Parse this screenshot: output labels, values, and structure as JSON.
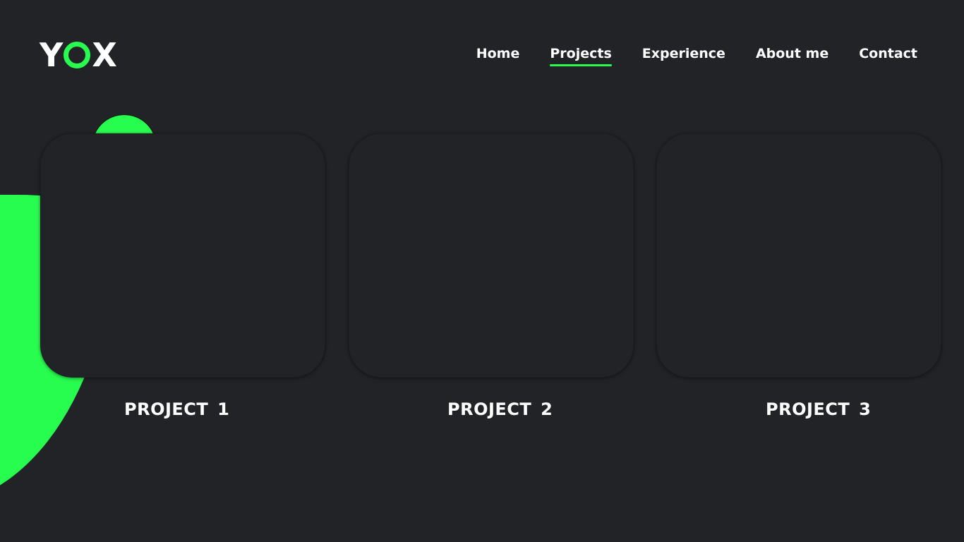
{
  "brand": {
    "logo_left": "Y",
    "logo_right": "X",
    "accent_color": "#27fd4f",
    "background_color": "#222327"
  },
  "nav": {
    "items": [
      {
        "label": "Home",
        "active": false
      },
      {
        "label": "Projects",
        "active": true
      },
      {
        "label": "Experience",
        "active": false
      },
      {
        "label": "About me",
        "active": false
      },
      {
        "label": "Contact",
        "active": false
      }
    ]
  },
  "projects": [
    {
      "title": "PROJECT 1"
    },
    {
      "title": "PROJECT 2"
    },
    {
      "title": "PROJECT 3"
    }
  ]
}
